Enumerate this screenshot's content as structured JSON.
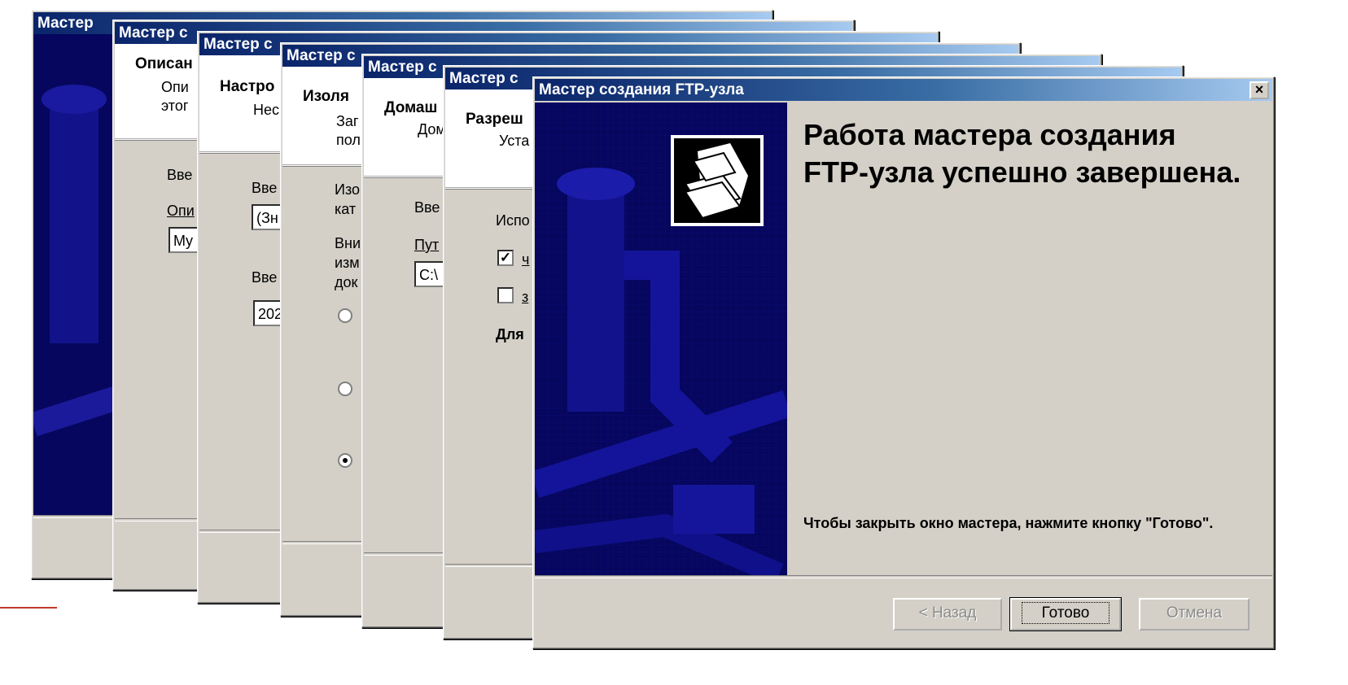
{
  "window_title_short": "Мастер",
  "dialogs": [
    {
      "title": "Мастер с",
      "header_title": "Описан",
      "header_sub": "Опи\nэтог",
      "body": [
        "Вве",
        "Опи"
      ],
      "field": "My"
    },
    {
      "title": "Мастер с",
      "header_title": "Настро",
      "header_sub": "Нес",
      "body": [
        "Вве",
        "Вве"
      ],
      "fields": [
        "(Зн",
        "202"
      ]
    },
    {
      "title": "Мастер с",
      "header_title": "Изоля",
      "header_sub": "Заг\nпол",
      "body": [
        "Изо\nкат",
        "Вни\nизм\nдок"
      ]
    },
    {
      "title": "Мастер с",
      "header_title": "Домаш",
      "header_sub": "Дом",
      "body": [
        "Вве",
        "Пут"
      ],
      "field": "C:\\"
    },
    {
      "title": "Мастер с",
      "header_title": "Разреш",
      "header_sub": "Уста",
      "body": [
        "Испо",
        "Для"
      ],
      "checks": [
        "ч",
        "з"
      ]
    }
  ],
  "front": {
    "title": "Мастер создания FTP-узла",
    "heading": "Работа мастера создания FTP-узла успешно завершена.",
    "closing_text": "Чтобы закрыть окно мастера, нажмите кнопку \"Готово\".",
    "buttons": {
      "back": "< Назад",
      "finish": "Готово",
      "cancel": "Отмена"
    }
  },
  "colors": {
    "titlebar": "#0a246a",
    "dialog_bg": "#d4d0c8",
    "wizard_art": "#06065e"
  }
}
